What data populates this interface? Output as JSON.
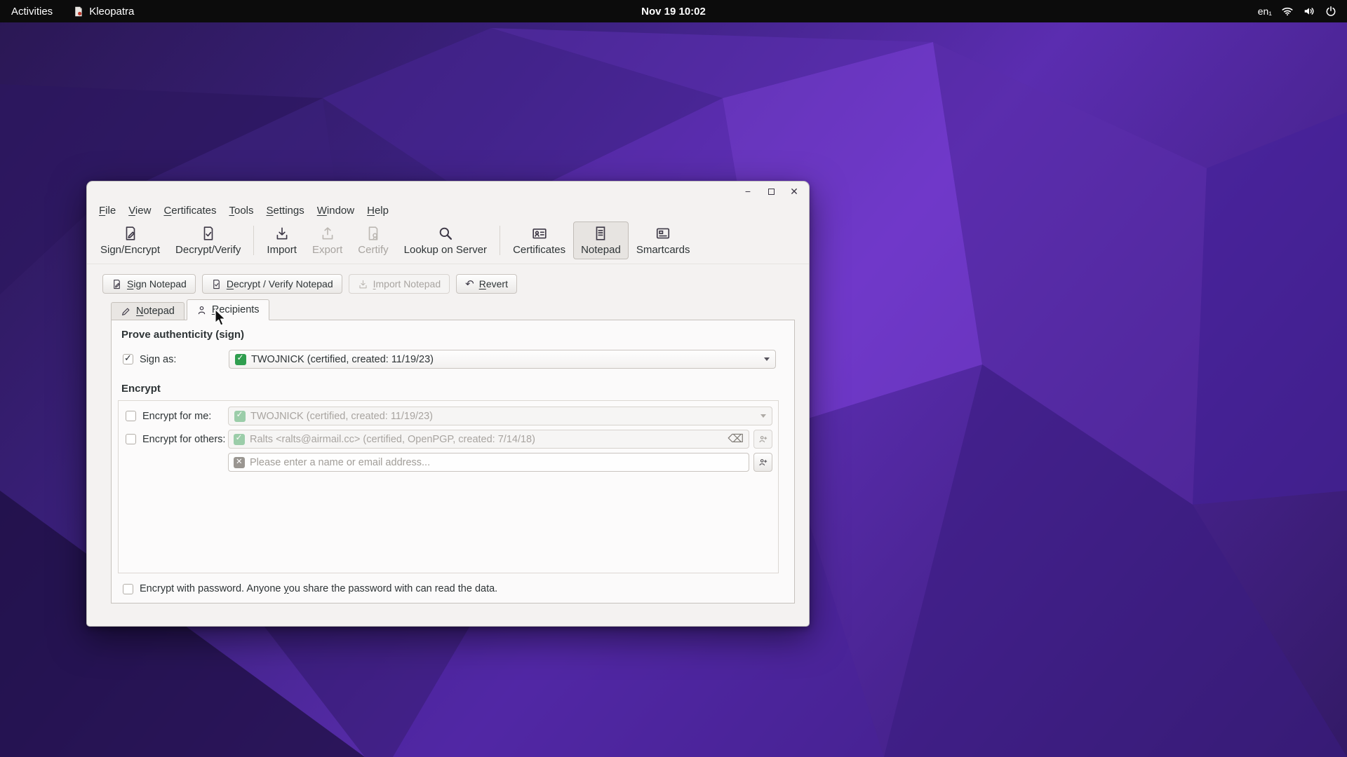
{
  "topbar": {
    "activities": "Activities",
    "app_name": "Kleopatra",
    "clock": "Nov 19 10:02",
    "keyboard_layout": "en₁"
  },
  "window": {
    "menu": {
      "items": [
        "File",
        "View",
        "Certificates",
        "Tools",
        "Settings",
        "Window",
        "Help"
      ]
    },
    "toolbar": {
      "items": [
        {
          "label": "Sign/Encrypt"
        },
        {
          "label": "Decrypt/Verify"
        },
        {
          "label": "Import"
        },
        {
          "label": "Export"
        },
        {
          "label": "Certify"
        },
        {
          "label": "Lookup on Server"
        },
        {
          "label": "Certificates"
        },
        {
          "label": "Notepad"
        },
        {
          "label": "Smartcards"
        }
      ]
    },
    "actions": {
      "sign": "Sign Notepad",
      "decrypt_verify": "Decrypt / Verify Notepad",
      "import": "Import Notepad",
      "revert": "Revert"
    },
    "tabs": {
      "notepad": "Notepad",
      "recipients": "Recipients"
    },
    "panel": {
      "sign_section": "Prove authenticity (sign)",
      "sign_as_label": "Sign as:",
      "sign_as_value": "TWOJNICK (certified, created: 11/19/23)",
      "encrypt_section": "Encrypt",
      "encrypt_me_label": "Encrypt for me:",
      "encrypt_me_value": "TWOJNICK (certified, created: 11/19/23)",
      "encrypt_others_label": "Encrypt for others:",
      "encrypt_others_value": "Ralts <ralts@airmail.cc> (certified, OpenPGP, created: 7/14/18)",
      "recipient_placeholder": "Please enter a name or email address...",
      "password_label": "Encrypt with password. Anyone you share the password with can read the data."
    }
  }
}
